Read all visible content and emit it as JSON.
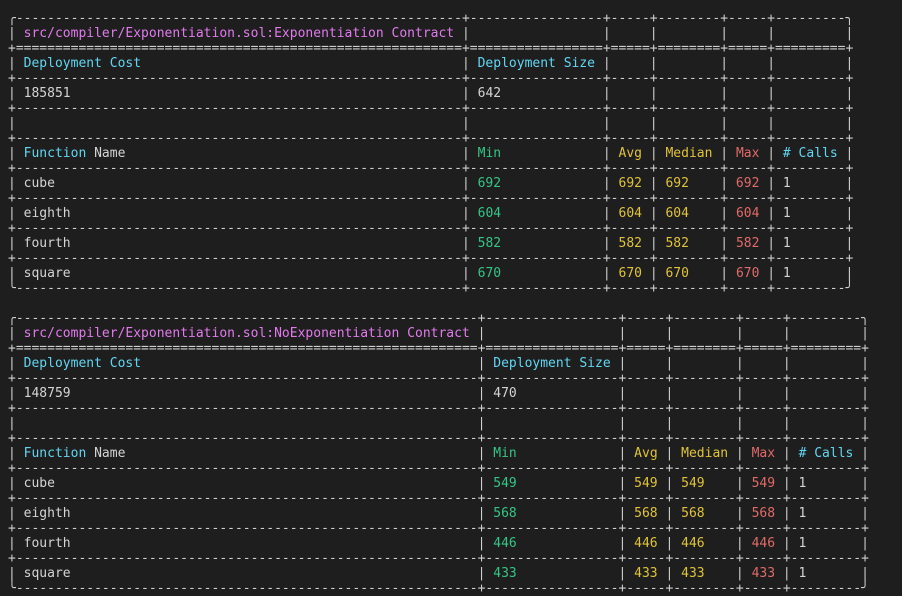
{
  "reports": [
    {
      "title": "src/compiler/Exponentiation.sol:Exponentiation Contract",
      "headers": {
        "deployment_cost": "Deployment Cost",
        "deployment_size": "Deployment Size",
        "function_label": "Function",
        "name_label": "Name",
        "min": "Min",
        "avg": "Avg",
        "median": "Median",
        "max": "Max",
        "calls": "# Calls"
      },
      "deployment": {
        "cost": "185851",
        "size": "642"
      },
      "functions": [
        {
          "name": "cube",
          "min": "692",
          "avg": "692",
          "median": "692",
          "max": "692",
          "calls": "1"
        },
        {
          "name": "eighth",
          "min": "604",
          "avg": "604",
          "median": "604",
          "max": "604",
          "calls": "1"
        },
        {
          "name": "fourth",
          "min": "582",
          "avg": "582",
          "median": "582",
          "max": "582",
          "calls": "1"
        },
        {
          "name": "square",
          "min": "670",
          "avg": "670",
          "median": "670",
          "max": "670",
          "calls": "1"
        }
      ]
    },
    {
      "title": "src/compiler/Exponentiation.sol:NoExponentiation Contract",
      "headers": {
        "deployment_cost": "Deployment Cost",
        "deployment_size": "Deployment Size",
        "function_label": "Function",
        "name_label": "Name",
        "min": "Min",
        "avg": "Avg",
        "median": "Median",
        "max": "Max",
        "calls": "# Calls"
      },
      "deployment": {
        "cost": "148759",
        "size": "470"
      },
      "functions": [
        {
          "name": "cube",
          "min": "549",
          "avg": "549",
          "median": "549",
          "max": "549",
          "calls": "1"
        },
        {
          "name": "eighth",
          "min": "568",
          "avg": "568",
          "median": "568",
          "max": "568",
          "calls": "1"
        },
        {
          "name": "fourth",
          "min": "446",
          "avg": "446",
          "median": "446",
          "max": "446",
          "calls": "1"
        },
        {
          "name": "square",
          "min": "433",
          "avg": "433",
          "median": "433",
          "max": "433",
          "calls": "1"
        }
      ]
    }
  ]
}
